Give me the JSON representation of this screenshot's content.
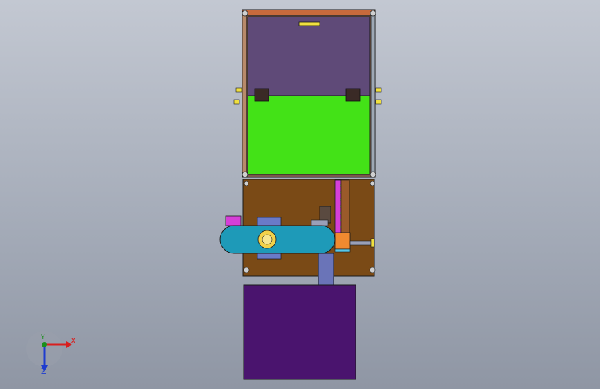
{
  "viewport": {
    "background_top": "#c3c8d2",
    "background_bottom": "#8f96a4"
  },
  "colors": {
    "frame_outline": "#1a1a1a",
    "frame_top_rail": "#c86a3c",
    "purple_panel": "#5f4a78",
    "green_panel": "#43e217",
    "base_plate": "#7a4a16",
    "pink_rail": "#d63fd8",
    "orange_block": "#f08a30",
    "blue_arm": "#1e9ab8",
    "lower_box": "#4a146e",
    "column": "#6a74b8",
    "yellow_pin": "#f0e040"
  },
  "triad": {
    "x_label": "X",
    "y_label": "Y",
    "z_label": "Z",
    "x_color": "#d81e1e",
    "y_color": "#1a8f1a",
    "z_color": "#1e3ccf"
  }
}
